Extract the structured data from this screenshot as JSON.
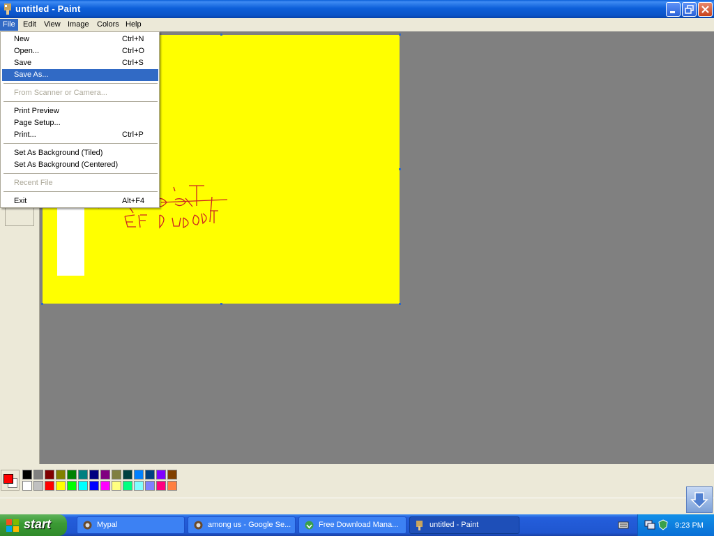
{
  "window": {
    "title": "untitled - Paint"
  },
  "menubar": [
    "File",
    "Edit",
    "View",
    "Image",
    "Colors",
    "Help"
  ],
  "file_menu": {
    "items": [
      {
        "label": "New",
        "shortcut": "Ctrl+N",
        "state": "normal"
      },
      {
        "label": "Open...",
        "shortcut": "Ctrl+O",
        "state": "normal"
      },
      {
        "label": "Save",
        "shortcut": "Ctrl+S",
        "state": "normal"
      },
      {
        "label": "Save As...",
        "shortcut": "",
        "state": "highlighted"
      },
      {
        "label": "From Scanner or Camera...",
        "shortcut": "",
        "state": "disabled"
      },
      {
        "label": "Print Preview",
        "shortcut": "",
        "state": "normal"
      },
      {
        "label": "Page Setup...",
        "shortcut": "",
        "state": "normal"
      },
      {
        "label": "Print...",
        "shortcut": "Ctrl+P",
        "state": "normal"
      },
      {
        "label": "Set As Background (Tiled)",
        "shortcut": "",
        "state": "normal"
      },
      {
        "label": "Set As Background (Centered)",
        "shortcut": "",
        "state": "normal"
      },
      {
        "label": "Recent File",
        "shortcut": "",
        "state": "disabled"
      },
      {
        "label": "Exit",
        "shortcut": "Alt+F4",
        "state": "normal"
      }
    ]
  },
  "canvas": {
    "background": "#ffff00"
  },
  "palette": {
    "foreground": "#ff0000",
    "background": "#ffffff",
    "colors": [
      "#000000",
      "#808080",
      "#800000",
      "#808000",
      "#008000",
      "#008080",
      "#000080",
      "#800080",
      "#808040",
      "#004040",
      "#0080ff",
      "#004080",
      "#8000ff",
      "#804000",
      "#ffffff",
      "#c0c0c0",
      "#ff0000",
      "#ffff00",
      "#00ff00",
      "#00ffff",
      "#0000ff",
      "#ff00ff",
      "#ffff80",
      "#00ff80",
      "#80ffff",
      "#8080ff",
      "#ff0080",
      "#ff8040"
    ]
  },
  "taskbar": {
    "start_label": "start",
    "tasks": [
      {
        "label": "Mypal",
        "active": false
      },
      {
        "label": "among us - Google Se...",
        "active": false
      },
      {
        "label": "Free Download Mana...",
        "active": false
      },
      {
        "label": "untitled - Paint",
        "active": true
      }
    ],
    "clock": "9:23 PM"
  }
}
